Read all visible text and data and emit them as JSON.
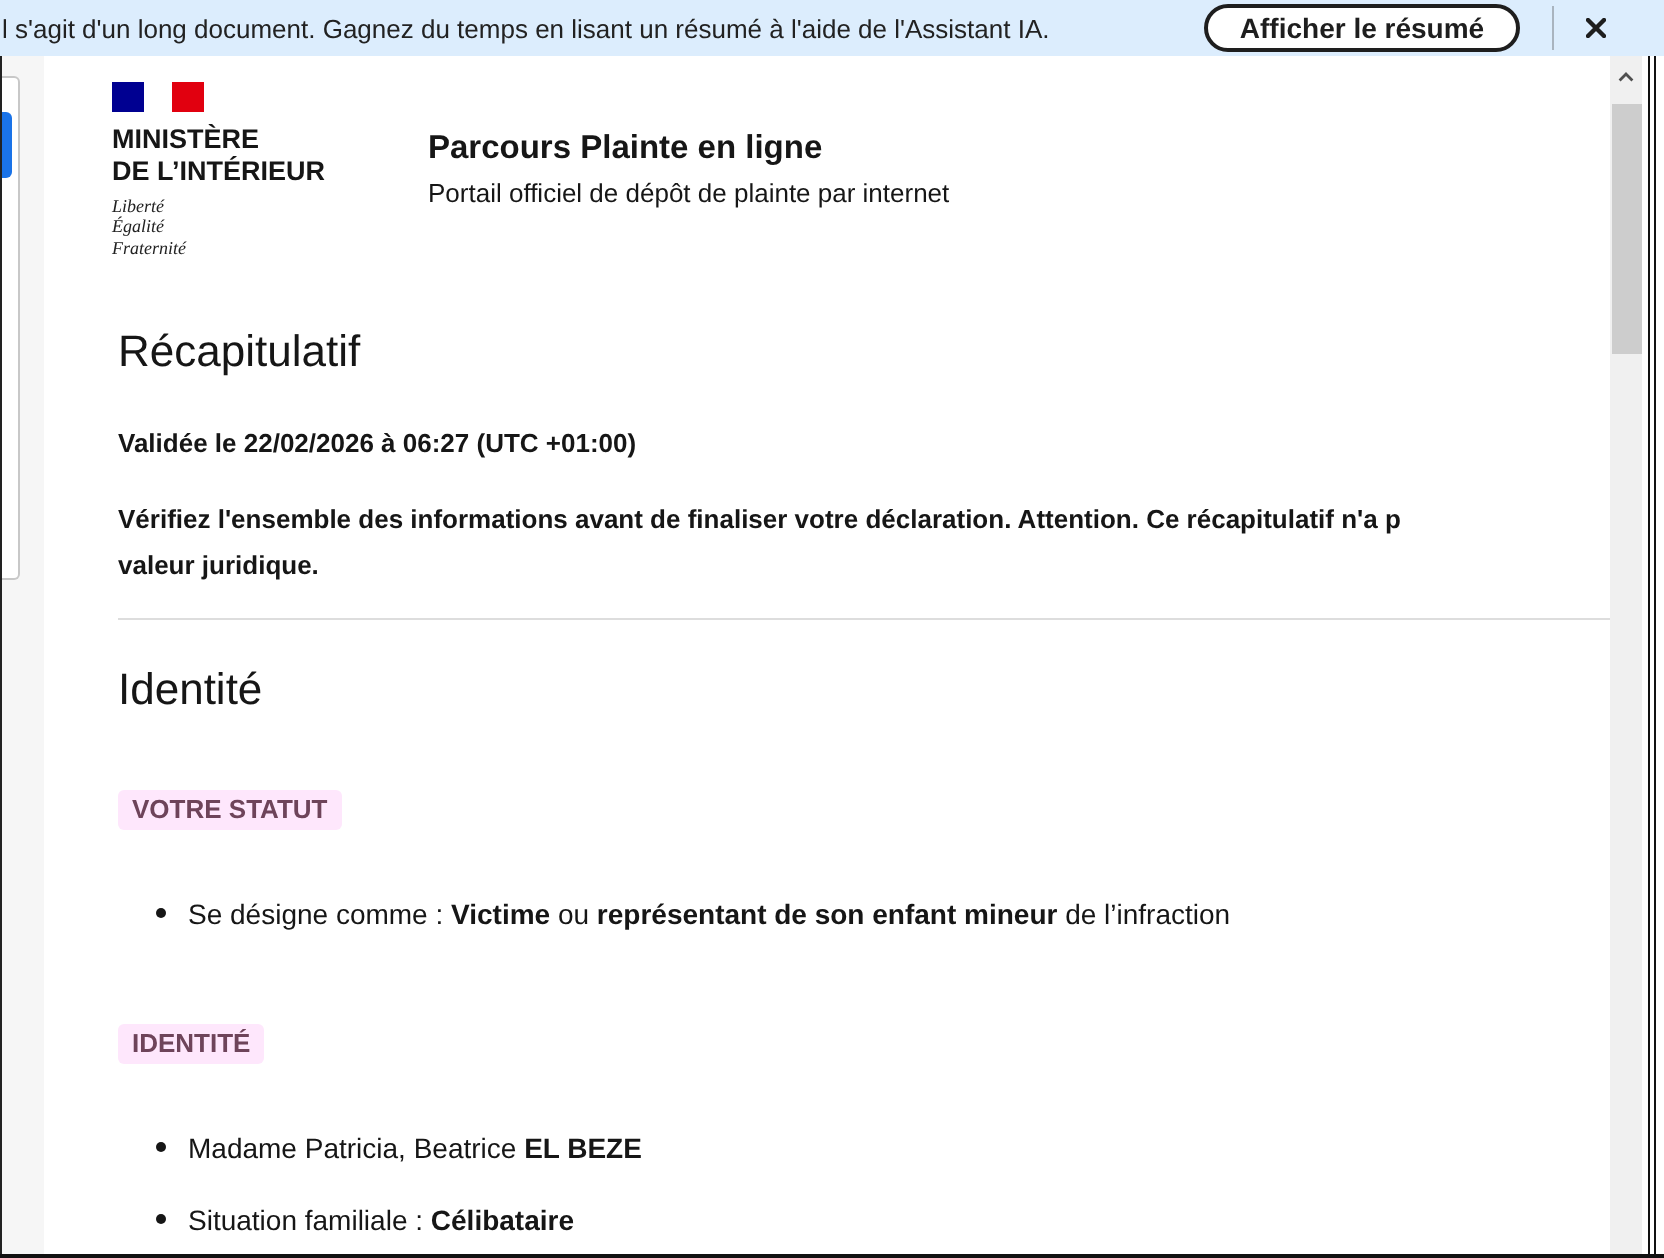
{
  "banner": {
    "message": "l s'agit d'un long document. Gagnez du temps en lisant un résumé à l'aide de l'Assistant IA.",
    "button": "Afficher le résumé"
  },
  "header": {
    "logo": {
      "name_lines": [
        "MINISTÈRE",
        "DE L’INTÉRIEUR"
      ],
      "motto_lines": [
        "Liberté",
        "Égalité",
        "Fraternité"
      ]
    },
    "title": "Parcours Plainte en ligne",
    "subtitle": "Portail officiel de dépôt de plainte par internet"
  },
  "summary": {
    "heading": "Récapitulatif",
    "validated": "Validée le 22/02/2026 à 06:27 (UTC +01:00)",
    "notice": "Vérifiez l'ensemble des informations avant de finaliser votre déclaration. Attention. Ce récapitulatif n'a p\nvaleur juridique."
  },
  "sections": [
    {
      "heading": "Identité",
      "groups": [
        {
          "tag": "VOTRE STATUT",
          "items": [
            "Se désigne comme : **Victime** ou **représentant de son enfant mineur** de l’infraction"
          ]
        },
        {
          "tag": "IDENTITÉ",
          "items": [
            "Madame Patricia, Beatrice **EL BEZE**",
            "Situation familiale : **Célibataire**"
          ]
        }
      ]
    }
  ]
}
